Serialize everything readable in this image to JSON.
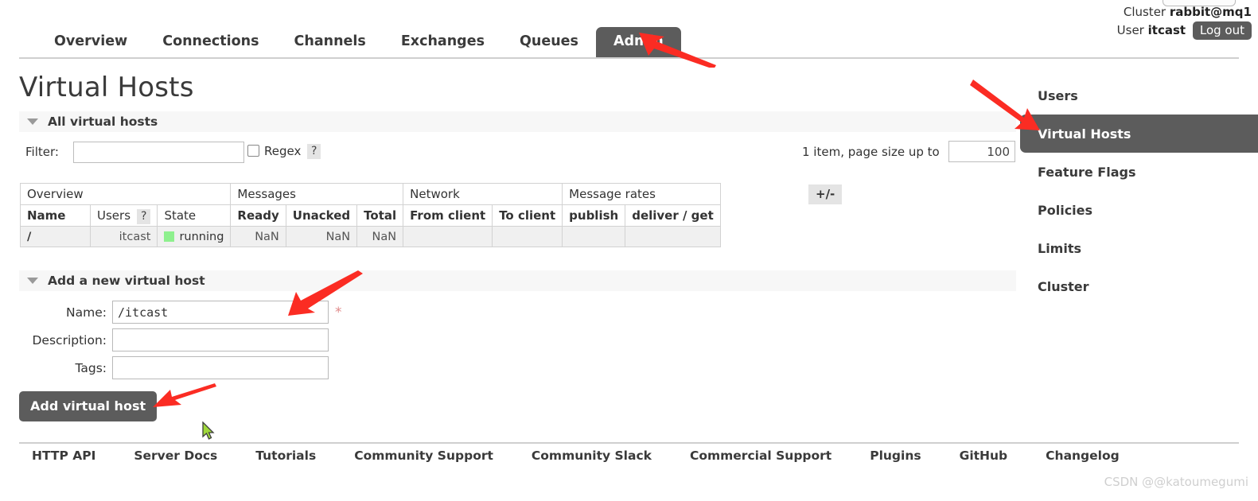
{
  "header": {
    "cluster_prefix": "Cluster",
    "cluster_name": "rabbit@mq1",
    "user_prefix": "User",
    "user_name": "itcast",
    "logout_label": "Log out"
  },
  "nav": {
    "tabs": [
      {
        "label": "Overview",
        "active": false
      },
      {
        "label": "Connections",
        "active": false
      },
      {
        "label": "Channels",
        "active": false
      },
      {
        "label": "Exchanges",
        "active": false
      },
      {
        "label": "Queues",
        "active": false
      },
      {
        "label": "Admin",
        "active": true
      }
    ]
  },
  "page": {
    "title": "Virtual Hosts"
  },
  "sections": {
    "all_hosts_label": "All virtual hosts",
    "add_host_label": "Add a new virtual host"
  },
  "filter": {
    "label": "Filter:",
    "value": "",
    "placeholder": "",
    "regex_label": "Regex",
    "regex_checked": false,
    "help_label": "?",
    "pager_text": "1 item, page size up to",
    "page_size": "100"
  },
  "table": {
    "group_headers": [
      {
        "label": "Overview",
        "span": 3
      },
      {
        "label": "Messages",
        "span": 3
      },
      {
        "label": "Network",
        "span": 2
      },
      {
        "label": "Message rates",
        "span": 2
      }
    ],
    "columns": [
      {
        "label": "Name",
        "bold": true
      },
      {
        "label": "Users",
        "bold": false,
        "help": "?"
      },
      {
        "label": "State",
        "bold": false
      },
      {
        "label": "Ready",
        "bold": true
      },
      {
        "label": "Unacked",
        "bold": true
      },
      {
        "label": "Total",
        "bold": true
      },
      {
        "label": "From client",
        "bold": true
      },
      {
        "label": "To client",
        "bold": true
      },
      {
        "label": "publish",
        "bold": true
      },
      {
        "label": "deliver / get",
        "bold": true
      }
    ],
    "rows": [
      {
        "name": "/",
        "users": "itcast",
        "state": "running",
        "state_color": "#8ef08e",
        "ready": "NaN",
        "unacked": "NaN",
        "total": "NaN",
        "from_client": "",
        "to_client": "",
        "publish": "",
        "deliver_get": ""
      }
    ],
    "toggle_columns_label": "+/-"
  },
  "add_form": {
    "fields": [
      {
        "label": "Name:",
        "value": "/itcast",
        "mono": true,
        "required": true
      },
      {
        "label": "Description:",
        "value": "",
        "mono": false,
        "required": false
      },
      {
        "label": "Tags:",
        "value": "",
        "mono": false,
        "required": false
      }
    ],
    "required_marker": "*",
    "submit_label": "Add virtual host"
  },
  "sidebar": {
    "items": [
      {
        "label": "Users",
        "active": false
      },
      {
        "label": "Virtual Hosts",
        "active": true
      },
      {
        "label": "Feature Flags",
        "active": false
      },
      {
        "label": "Policies",
        "active": false
      },
      {
        "label": "Limits",
        "active": false
      },
      {
        "label": "Cluster",
        "active": false
      }
    ]
  },
  "footer": {
    "links": [
      "HTTP API",
      "Server Docs",
      "Tutorials",
      "Community Support",
      "Community Slack",
      "Commercial Support",
      "Plugins",
      "GitHub",
      "Changelog"
    ]
  },
  "watermark": {
    "text": "CSDN @@katoumegumi"
  },
  "annotations": {
    "arrow_color": "#fb2c23",
    "arrows": [
      {
        "name": "arrow-to-admin-tab"
      },
      {
        "name": "arrow-to-virtual-hosts-sidebar"
      },
      {
        "name": "arrow-to-name-field"
      },
      {
        "name": "arrow-to-add-virtual-host-button"
      }
    ]
  },
  "colors": {
    "accent_dark": "#5c5c5c",
    "state_running": "#8ef08e",
    "annotation_red": "#fb2c23"
  }
}
